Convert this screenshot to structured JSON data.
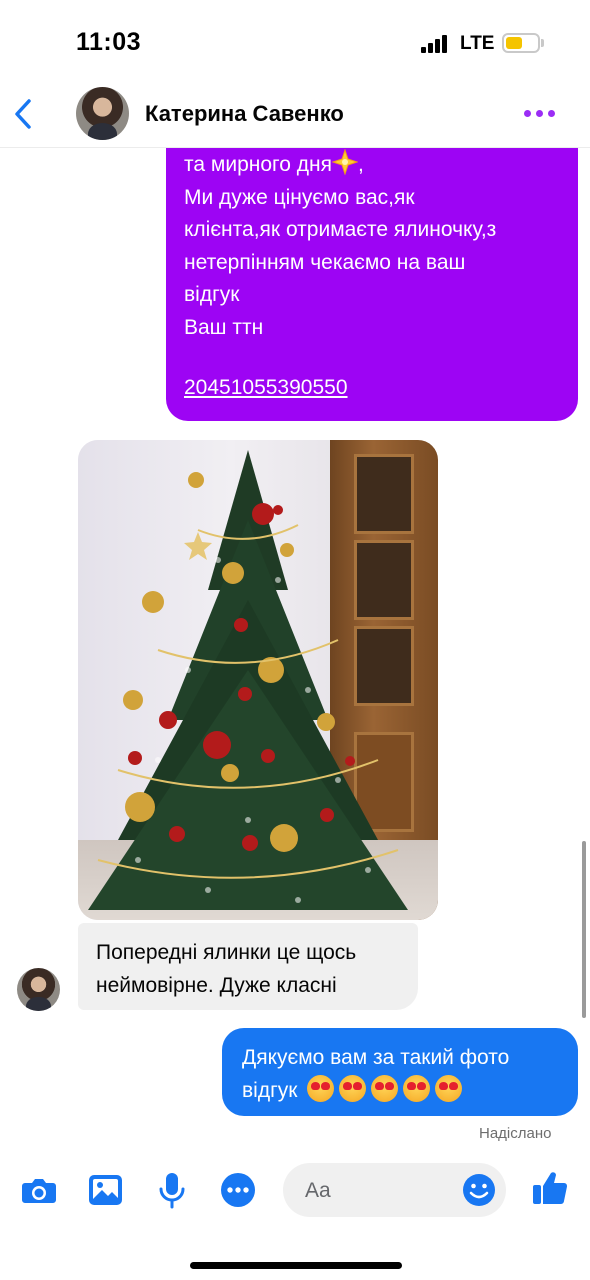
{
  "status_bar": {
    "time": "11:03",
    "network": "LTE",
    "battery_color": "#f5c400"
  },
  "header": {
    "contact_name": "Катерина Савенко",
    "back_icon": "chevron-left-icon",
    "more_icon": "more-dots-icon",
    "accent_color": "#9b2df5"
  },
  "messages": {
    "outgoing_offer": {
      "lines": [
        "та мирного дня",
        "Ми дуже цінуємо вас,як",
        "клієнта,як отримаєте ялиночку,з",
        "нетерпінням чекаємо на ваш",
        "відгук",
        "Ваш ттн"
      ],
      "line1_suffix": ",",
      "ttn_number": "20451055390550",
      "bubble_color": "#9d04f4"
    },
    "incoming_text": {
      "lines": [
        "Попередні ялинки це щось",
        "неймовірне. Дуже класні"
      ]
    },
    "outgoing_reply": {
      "lines": [
        "Дякуємо вам за такий фото",
        "відгук"
      ],
      "emoji_count": 5,
      "emoji_name": "heart-eyes-emoji",
      "bubble_color": "#1877f2"
    },
    "status": "Надіслано"
  },
  "composer": {
    "placeholder": "Aa",
    "icons": [
      "camera-icon",
      "gallery-icon",
      "microphone-icon",
      "more-options-icon",
      "emoji-icon",
      "like-icon"
    ],
    "icon_color": "#1877f2"
  }
}
